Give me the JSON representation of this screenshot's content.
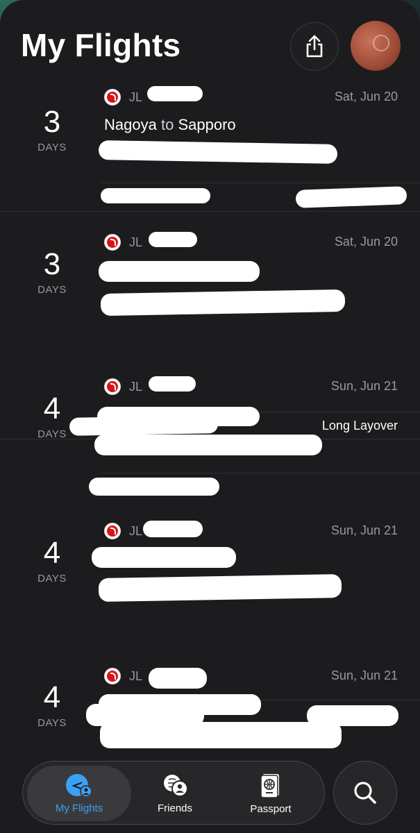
{
  "header": {
    "title": "My Flights"
  },
  "flights": [
    {
      "days": "3",
      "days_label": "DAYS",
      "flight_code": "JL",
      "date": "Sat, Jun 20",
      "route_from": "Nagoya",
      "route_to_word": "to",
      "route_dest": "Sapporo"
    },
    {
      "days": "3",
      "days_label": "DAYS",
      "flight_code": "JL",
      "date": "Sat, Jun 20",
      "layover": "Long Layover"
    },
    {
      "days": "4",
      "days_label": "DAYS",
      "flight_code": "JL",
      "date": "Sun, Jun 21"
    },
    {
      "days": "4",
      "days_label": "DAYS",
      "flight_code": "JL",
      "date": "Sun, Jun 21"
    },
    {
      "days": "4",
      "days_label": "DAYS",
      "flight_code": "JL",
      "date": "Sun, Jun 21"
    }
  ],
  "tabbar": {
    "tabs": [
      {
        "label": "My Flights",
        "icon": "plane-user-icon",
        "active": true
      },
      {
        "label": "Friends",
        "icon": "friends-icon",
        "active": false
      },
      {
        "label": "Passport",
        "icon": "passport-icon",
        "active": false
      }
    ],
    "search_icon": "search-icon"
  },
  "colors": {
    "accent": "#3aa2f5",
    "background": "#1c1c1e",
    "airline_red": "#d5141c"
  }
}
